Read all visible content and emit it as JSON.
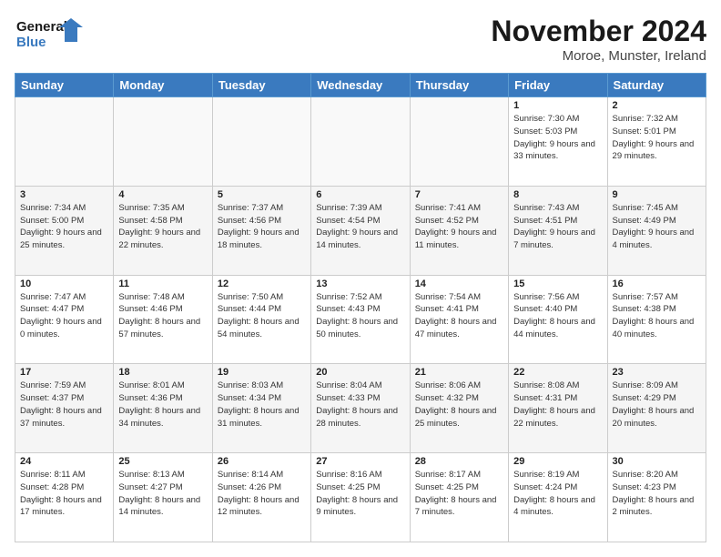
{
  "header": {
    "logo_line1": "General",
    "logo_line2": "Blue",
    "month": "November 2024",
    "location": "Moroe, Munster, Ireland"
  },
  "days_of_week": [
    "Sunday",
    "Monday",
    "Tuesday",
    "Wednesday",
    "Thursday",
    "Friday",
    "Saturday"
  ],
  "weeks": [
    [
      {
        "day": "",
        "info": ""
      },
      {
        "day": "",
        "info": ""
      },
      {
        "day": "",
        "info": ""
      },
      {
        "day": "",
        "info": ""
      },
      {
        "day": "",
        "info": ""
      },
      {
        "day": "1",
        "info": "Sunrise: 7:30 AM\nSunset: 5:03 PM\nDaylight: 9 hours and 33 minutes."
      },
      {
        "day": "2",
        "info": "Sunrise: 7:32 AM\nSunset: 5:01 PM\nDaylight: 9 hours and 29 minutes."
      }
    ],
    [
      {
        "day": "3",
        "info": "Sunrise: 7:34 AM\nSunset: 5:00 PM\nDaylight: 9 hours and 25 minutes."
      },
      {
        "day": "4",
        "info": "Sunrise: 7:35 AM\nSunset: 4:58 PM\nDaylight: 9 hours and 22 minutes."
      },
      {
        "day": "5",
        "info": "Sunrise: 7:37 AM\nSunset: 4:56 PM\nDaylight: 9 hours and 18 minutes."
      },
      {
        "day": "6",
        "info": "Sunrise: 7:39 AM\nSunset: 4:54 PM\nDaylight: 9 hours and 14 minutes."
      },
      {
        "day": "7",
        "info": "Sunrise: 7:41 AM\nSunset: 4:52 PM\nDaylight: 9 hours and 11 minutes."
      },
      {
        "day": "8",
        "info": "Sunrise: 7:43 AM\nSunset: 4:51 PM\nDaylight: 9 hours and 7 minutes."
      },
      {
        "day": "9",
        "info": "Sunrise: 7:45 AM\nSunset: 4:49 PM\nDaylight: 9 hours and 4 minutes."
      }
    ],
    [
      {
        "day": "10",
        "info": "Sunrise: 7:47 AM\nSunset: 4:47 PM\nDaylight: 9 hours and 0 minutes."
      },
      {
        "day": "11",
        "info": "Sunrise: 7:48 AM\nSunset: 4:46 PM\nDaylight: 8 hours and 57 minutes."
      },
      {
        "day": "12",
        "info": "Sunrise: 7:50 AM\nSunset: 4:44 PM\nDaylight: 8 hours and 54 minutes."
      },
      {
        "day": "13",
        "info": "Sunrise: 7:52 AM\nSunset: 4:43 PM\nDaylight: 8 hours and 50 minutes."
      },
      {
        "day": "14",
        "info": "Sunrise: 7:54 AM\nSunset: 4:41 PM\nDaylight: 8 hours and 47 minutes."
      },
      {
        "day": "15",
        "info": "Sunrise: 7:56 AM\nSunset: 4:40 PM\nDaylight: 8 hours and 44 minutes."
      },
      {
        "day": "16",
        "info": "Sunrise: 7:57 AM\nSunset: 4:38 PM\nDaylight: 8 hours and 40 minutes."
      }
    ],
    [
      {
        "day": "17",
        "info": "Sunrise: 7:59 AM\nSunset: 4:37 PM\nDaylight: 8 hours and 37 minutes."
      },
      {
        "day": "18",
        "info": "Sunrise: 8:01 AM\nSunset: 4:36 PM\nDaylight: 8 hours and 34 minutes."
      },
      {
        "day": "19",
        "info": "Sunrise: 8:03 AM\nSunset: 4:34 PM\nDaylight: 8 hours and 31 minutes."
      },
      {
        "day": "20",
        "info": "Sunrise: 8:04 AM\nSunset: 4:33 PM\nDaylight: 8 hours and 28 minutes."
      },
      {
        "day": "21",
        "info": "Sunrise: 8:06 AM\nSunset: 4:32 PM\nDaylight: 8 hours and 25 minutes."
      },
      {
        "day": "22",
        "info": "Sunrise: 8:08 AM\nSunset: 4:31 PM\nDaylight: 8 hours and 22 minutes."
      },
      {
        "day": "23",
        "info": "Sunrise: 8:09 AM\nSunset: 4:29 PM\nDaylight: 8 hours and 20 minutes."
      }
    ],
    [
      {
        "day": "24",
        "info": "Sunrise: 8:11 AM\nSunset: 4:28 PM\nDaylight: 8 hours and 17 minutes."
      },
      {
        "day": "25",
        "info": "Sunrise: 8:13 AM\nSunset: 4:27 PM\nDaylight: 8 hours and 14 minutes."
      },
      {
        "day": "26",
        "info": "Sunrise: 8:14 AM\nSunset: 4:26 PM\nDaylight: 8 hours and 12 minutes."
      },
      {
        "day": "27",
        "info": "Sunrise: 8:16 AM\nSunset: 4:25 PM\nDaylight: 8 hours and 9 minutes."
      },
      {
        "day": "28",
        "info": "Sunrise: 8:17 AM\nSunset: 4:25 PM\nDaylight: 8 hours and 7 minutes."
      },
      {
        "day": "29",
        "info": "Sunrise: 8:19 AM\nSunset: 4:24 PM\nDaylight: 8 hours and 4 minutes."
      },
      {
        "day": "30",
        "info": "Sunrise: 8:20 AM\nSunset: 4:23 PM\nDaylight: 8 hours and 2 minutes."
      }
    ]
  ]
}
